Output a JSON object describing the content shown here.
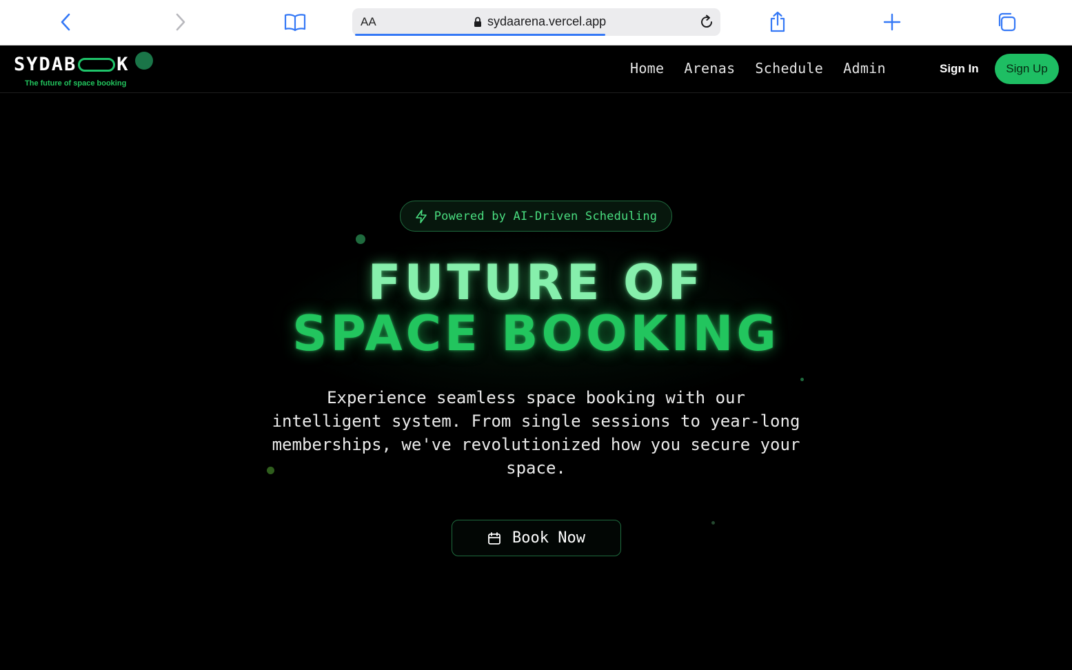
{
  "browser": {
    "address_prefix": "AA",
    "url": "sydaarena.vercel.app",
    "icons": [
      "back-icon",
      "forward-icon",
      "reader-book-icon",
      "lock-icon",
      "reload-icon",
      "share-icon",
      "plus-icon",
      "tabs-icon"
    ],
    "load_progress": 0.69
  },
  "site": {
    "logo_text_start": "SYDAB",
    "logo_text_end": "K",
    "tagline": "The future of space booking",
    "nav": [
      {
        "label": "Home"
      },
      {
        "label": "Arenas"
      },
      {
        "label": "Schedule"
      },
      {
        "label": "Admin"
      }
    ],
    "sign_in": "Sign In",
    "sign_up": "Sign Up",
    "accent_color": "#22c55e"
  },
  "hero": {
    "badge": "Powered by AI-Driven Scheduling",
    "title_line1": "FUTURE OF",
    "title_line2": "SPACE BOOKING",
    "description": "Experience seamless space booking with our intelligent system. From single sessions to year-long memberships, we've revolutionized how you secure your space.",
    "cta": "Book Now"
  }
}
